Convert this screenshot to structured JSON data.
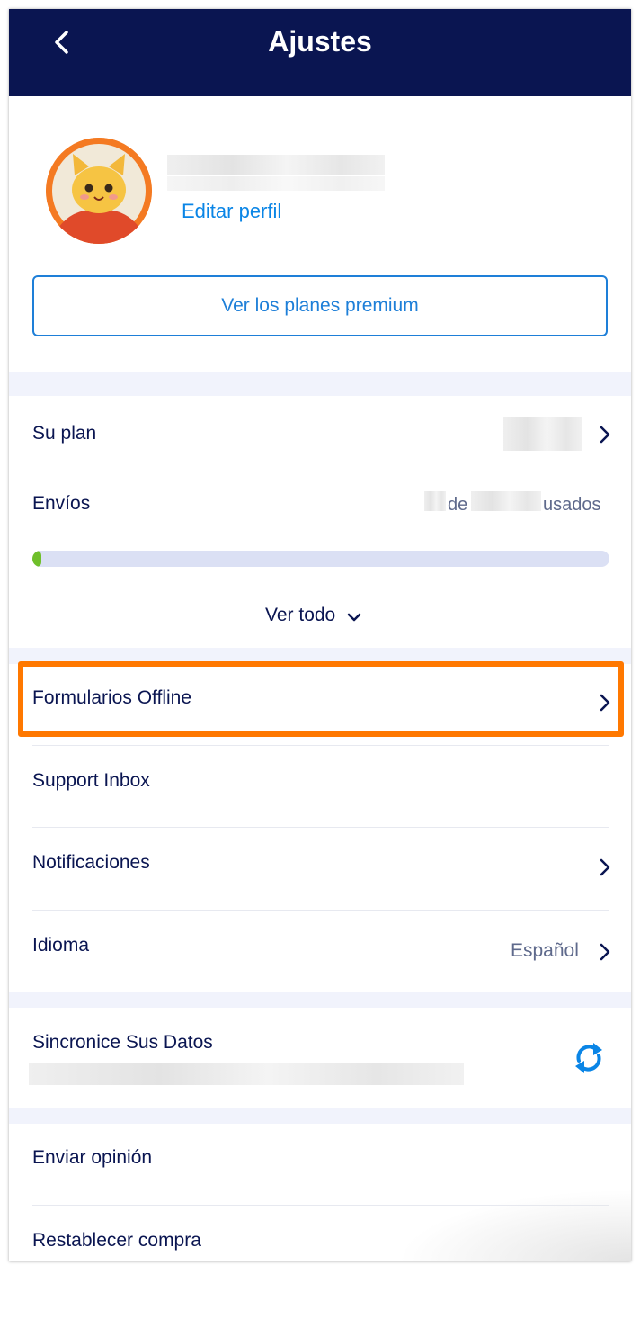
{
  "header": {
    "title": "Ajustes",
    "back_icon": "chevron-left-icon"
  },
  "profile": {
    "edit_link": "Editar perfil",
    "avatar_icon": "cat-avatar-icon"
  },
  "premium_button": "Ver los planes premium",
  "plan": {
    "your_plan_label": "Su plan",
    "submissions_label": "Envíos",
    "of_word": "de",
    "used_word": "usados",
    "progress_fraction": 0.015,
    "view_all_label": "Ver todo"
  },
  "menu": {
    "offline_forms": "Formularios Offline",
    "support_inbox": "Support Inbox",
    "notifications": "Notificaciones",
    "language_label": "Idioma",
    "language_value": "Español"
  },
  "sync": {
    "label": "Sincronice Sus Datos",
    "icon": "sync-icon"
  },
  "other": {
    "feedback": "Enviar opinión",
    "restore": "Restablecer compra"
  },
  "colors": {
    "header_bg": "#0a1551",
    "accent_blue": "#1e7fd8",
    "highlight_orange": "#ff7800",
    "progress_green": "#6fbf2a"
  }
}
